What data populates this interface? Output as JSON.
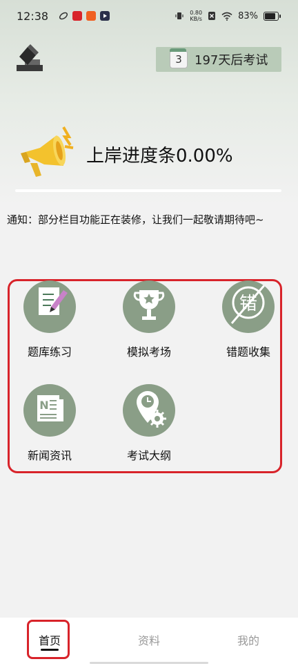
{
  "status_bar": {
    "time": "12:38",
    "net_speed_value": "0.80",
    "net_speed_unit": "KB/s",
    "battery": "83%"
  },
  "header": {
    "countdown_day": "3",
    "countdown_text": "197天后考试"
  },
  "progress": {
    "label": "上岸进度条0.00%",
    "fraction": 0.0
  },
  "notice": "通知：部分栏目功能正在装修，让我们一起敬请期待吧~",
  "features": [
    {
      "label": "题库练习",
      "icon": "notebook-pencil-icon"
    },
    {
      "label": "模拟考场",
      "icon": "trophy-icon"
    },
    {
      "label": "错题收集",
      "icon": "wrong-questions-icon",
      "glyph": "错"
    },
    {
      "label": "新闻资讯",
      "icon": "newspaper-icon",
      "glyph": "N"
    },
    {
      "label": "考试大纲",
      "icon": "location-gear-icon"
    }
  ],
  "bottom_nav": [
    {
      "label": "首页",
      "active": true
    },
    {
      "label": "资料",
      "active": false
    },
    {
      "label": "我的",
      "active": false
    }
  ],
  "colors": {
    "accent": "#8a9e87",
    "countdown_bg": "#b9cbb8",
    "highlight_red": "#d8232a"
  }
}
